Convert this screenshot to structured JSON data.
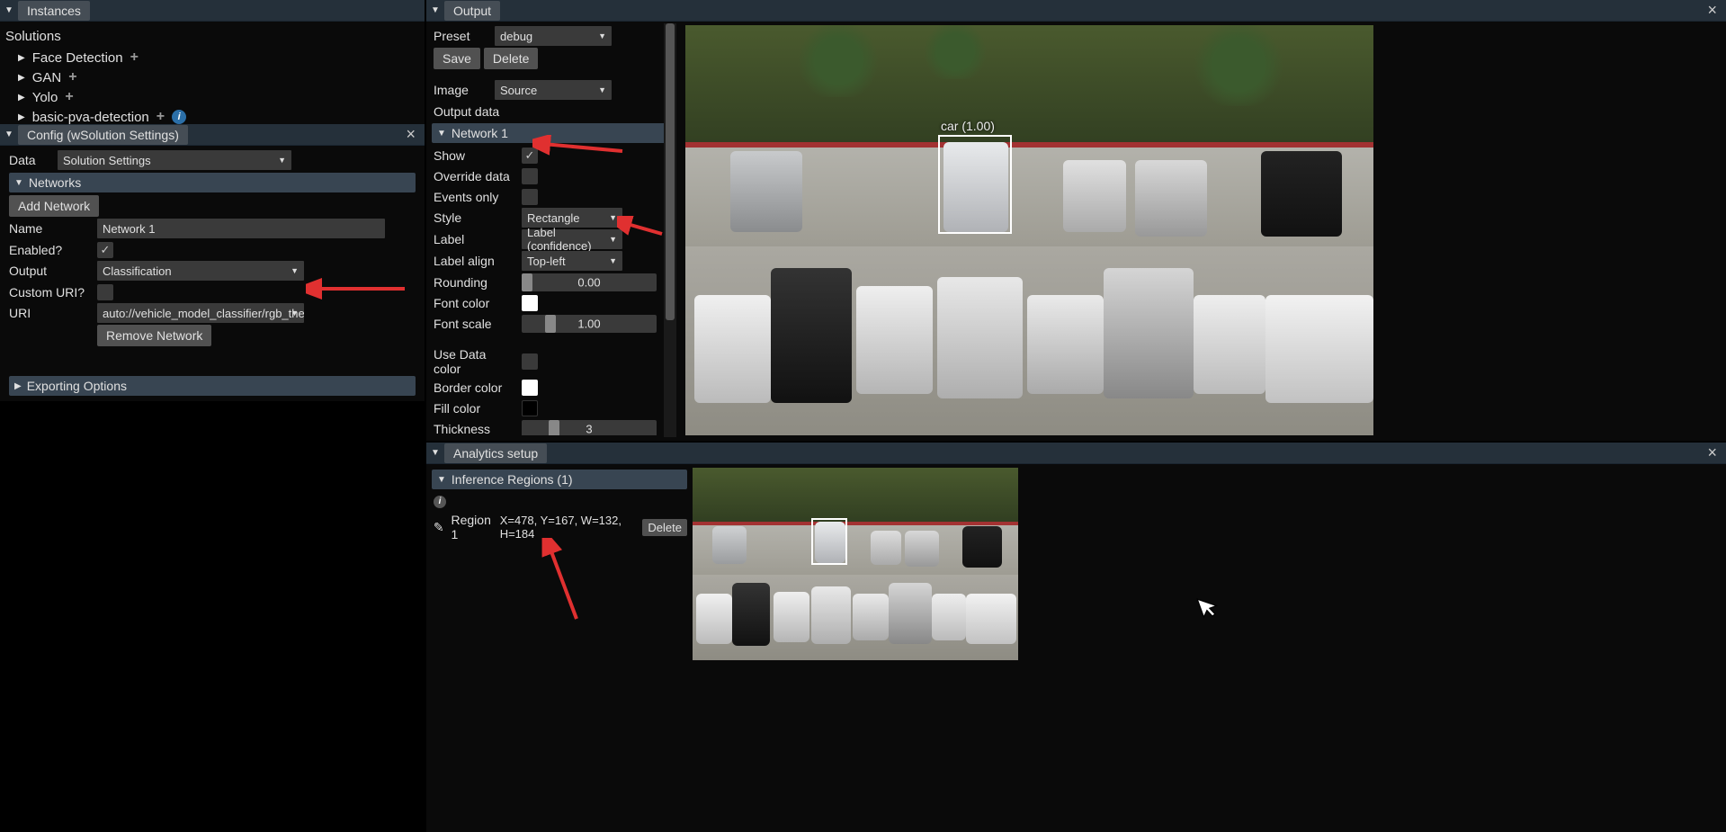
{
  "instances": {
    "title": "Instances",
    "solutions_label": "Solutions",
    "items": [
      {
        "label": "Face Detection"
      },
      {
        "label": "GAN"
      },
      {
        "label": "Yolo"
      },
      {
        "label": "basic-pva-detection",
        "info": true
      }
    ]
  },
  "config": {
    "title": "Config (wSolution Settings)",
    "data_label": "Data",
    "data_value": "Solution Settings",
    "networks_label": "Networks",
    "add_network": "Add Network",
    "name_label": "Name",
    "name_value": "Network 1",
    "enabled_label": "Enabled?",
    "enabled_checked": true,
    "output_label": "Output",
    "output_value": "Classification",
    "custom_uri_label": "Custom URI?",
    "uri_label": "URI",
    "uri_value": "auto://vehicle_model_classifier/rgb_thermal_",
    "remove_network": "Remove Network",
    "exporting_options": "Exporting Options"
  },
  "output": {
    "title": "Output",
    "preset_label": "Preset",
    "preset_value": "debug",
    "save": "Save",
    "delete": "Delete",
    "image_label": "Image",
    "image_value": "Source",
    "output_data": "Output data",
    "network1": "Network 1",
    "show": "Show",
    "override": "Override data",
    "events": "Events only",
    "style_label": "Style",
    "style_value": "Rectangle",
    "label_label": "Label",
    "label_value": "Label (confidence)",
    "align_label": "Label align",
    "align_value": "Top-left",
    "rounding_label": "Rounding",
    "rounding_value": "0.00",
    "fontcolor_label": "Font color",
    "fontcolor_value": "#ffffff",
    "fontscale_label": "Font scale",
    "fontscale_value": "1.00",
    "usedata_label": "Use Data color",
    "bordercolor_label": "Border color",
    "bordercolor_value": "#ffffff",
    "fillcolor_label": "Fill color",
    "fillcolor_value": "#000000",
    "thickness_label": "Thickness",
    "thickness_value": "3",
    "detection_label": "car (1.00)"
  },
  "analytics": {
    "title": "Analytics setup",
    "regions_label": "Inference Regions (1)",
    "region_name": "Region 1",
    "region_coords": "X=478, Y=167, W=132, H=184",
    "delete": "Delete"
  }
}
